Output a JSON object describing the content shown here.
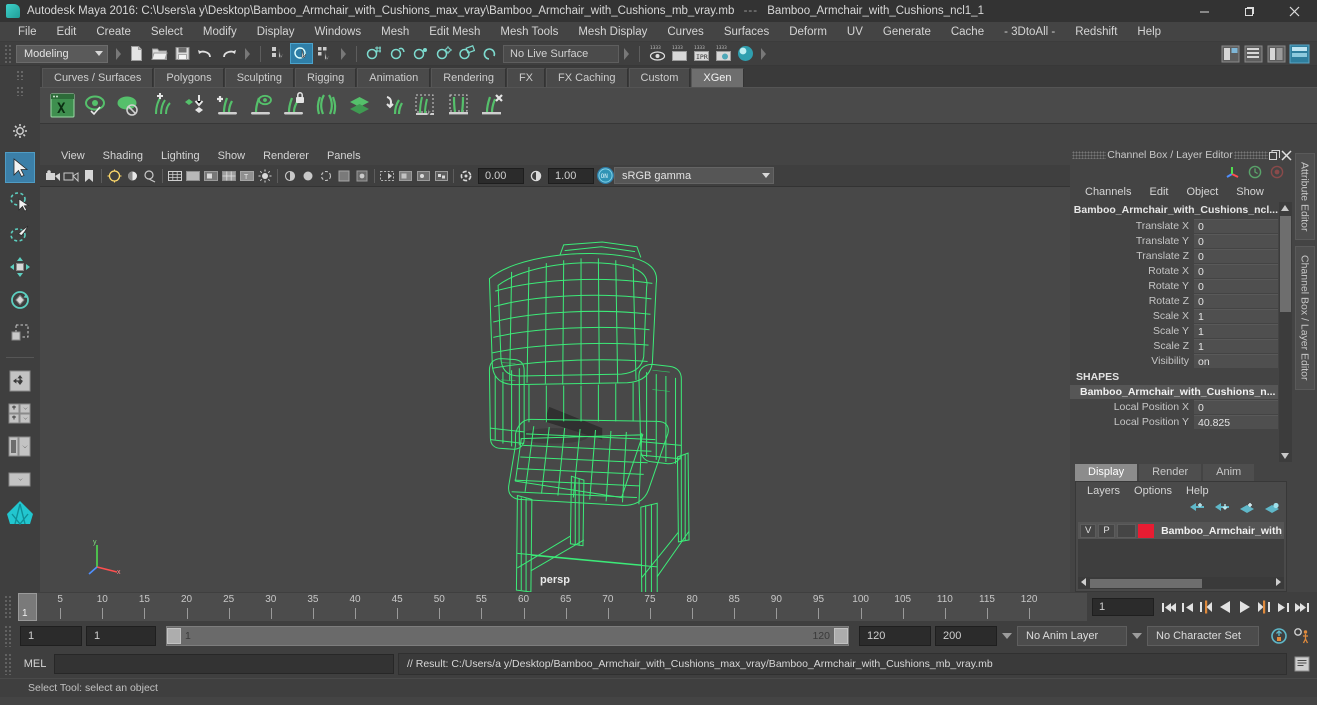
{
  "titlebar": {
    "app_title": "Autodesk Maya 2016: C:\\Users\\a y\\Desktop\\Bamboo_Armchair_with_Cushions_max_vray\\Bamboo_Armchair_with_Cushions_mb_vray.mb",
    "separator": "---",
    "selection_title": "Bamboo_Armchair_with_Cushions_ncl1_1",
    "minimize": "–",
    "maximize": "❐",
    "close": "✕"
  },
  "menubar": {
    "items": [
      "File",
      "Edit",
      "Create",
      "Select",
      "Modify",
      "Display",
      "Windows",
      "Mesh",
      "Edit Mesh",
      "Mesh Tools",
      "Mesh Display",
      "Curves",
      "Surfaces",
      "Deform",
      "UV",
      "Generate",
      "Cache",
      "- 3DtoAll -",
      "Redshift",
      "Help"
    ]
  },
  "statusline": {
    "mode": "Modeling",
    "live_surface": "No Live Surface",
    "icons": [
      "new-scene-icon",
      "open-scene-icon",
      "save-scene-icon",
      "undo-icon",
      "redo-icon",
      "select-hierarchy-icon",
      "select-object-icon",
      "select-component-icon",
      "snap-grid-icon",
      "snap-curve-icon",
      "snap-point-icon",
      "snap-projected-icon",
      "render-view-icon",
      "render-current-frame-icon",
      "ipr-render-icon",
      "render-settings-icon",
      "hypershade-icon"
    ]
  },
  "shelf": {
    "tabs": [
      "Curves / Surfaces",
      "Polygons",
      "Sculpting",
      "Rigging",
      "Animation",
      "Rendering",
      "FX",
      "FX Caching",
      "Custom",
      "XGen"
    ],
    "active_tab": "XGen",
    "icons": [
      "xgen-editor-icon",
      "xgen-preview-icon",
      "xgen-disable-preview-icon",
      "xgen-add-description-icon",
      "xgen-import-icon",
      "xgen-add-guide-icon",
      "xgen-guide-preview-icon",
      "xgen-lock-guide-icon",
      "xgen-part-guides-icon",
      "xgen-layers-icon",
      "xgen-clump-icon",
      "xgen-select-guides-icon",
      "xgen-region-icon",
      "xgen-delete-guides-icon"
    ]
  },
  "toolbox": {
    "tools": [
      "select-tool",
      "lasso-select-tool",
      "paint-select-tool",
      "move-tool",
      "rotate-tool",
      "scale-tool",
      "last-tool-used",
      "four-view-layout",
      "two-pane-layout",
      "outliner-persp-layout",
      "hypershade-persp-layout",
      "persp-layout"
    ],
    "active_tool": "select-tool"
  },
  "viewport": {
    "menus": [
      "View",
      "Shading",
      "Lighting",
      "Show",
      "Renderer",
      "Panels"
    ],
    "exposure_value": "0.00",
    "gamma_value": "1.00",
    "color_management": "sRGB gamma",
    "camera_label": "persp",
    "toolbar_icons": [
      "camera-attributes-icon",
      "bookmark-icon",
      "image-plane-icon",
      "grid-icon",
      "film-gate-icon",
      "resolution-gate-icon",
      "gate-mask-icon",
      "field-chart-icon",
      "safe-action-icon",
      "safe-title-icon",
      "xray-icon",
      "xray-joints-icon",
      "shadows-icon",
      "occlusion-icon",
      "aa-icon",
      "mblur-icon",
      "dof-icon",
      "wireframe-icon",
      "smooth-shade-icon",
      "flat-shade-icon",
      "wireframe-on-shaded-icon",
      "texture-icon",
      "lighting-icon",
      "shadow-icon",
      "two-sided-lighting-icon",
      "isolate-select-icon",
      "panel-zoom-icon",
      "exposure-icon",
      "gamma-icon",
      "color-management-toggle-icon"
    ]
  },
  "channelbox": {
    "panel_title": "Channel Box / Layer Editor",
    "menus": [
      "Channels",
      "Edit",
      "Object",
      "Show"
    ],
    "object_name": "Bamboo_Armchair_with_Cushions_ncl...",
    "attributes": [
      {
        "label": "Translate X",
        "value": "0"
      },
      {
        "label": "Translate Y",
        "value": "0"
      },
      {
        "label": "Translate Z",
        "value": "0"
      },
      {
        "label": "Rotate X",
        "value": "0"
      },
      {
        "label": "Rotate Y",
        "value": "0"
      },
      {
        "label": "Rotate Z",
        "value": "0"
      },
      {
        "label": "Scale X",
        "value": "1"
      },
      {
        "label": "Scale Y",
        "value": "1"
      },
      {
        "label": "Scale Z",
        "value": "1"
      },
      {
        "label": "Visibility",
        "value": "on"
      }
    ],
    "shapes_header": "SHAPES",
    "shape_name": "Bamboo_Armchair_with_Cushions_n...",
    "shape_attributes": [
      {
        "label": "Local Position X",
        "value": "0"
      },
      {
        "label": "Local Position Y",
        "value": "40.825"
      }
    ]
  },
  "layereditor": {
    "tabs": [
      "Display",
      "Render",
      "Anim"
    ],
    "active_tab": "Display",
    "menus": [
      "Layers",
      "Options",
      "Help"
    ],
    "icon_names": [
      "move-layer-up-icon",
      "move-layer-down-icon",
      "new-layer-icon",
      "new-layer-from-selected-icon"
    ],
    "layers": [
      {
        "visibility": "V",
        "playback": "P",
        "color": "#e81c32",
        "name": "Bamboo_Armchair_with_"
      }
    ]
  },
  "side_tabs": [
    "Attribute Editor",
    "Channel Box / Layer Editor"
  ],
  "timeline": {
    "start_label": "1",
    "ticks": [
      5,
      10,
      15,
      20,
      25,
      30,
      35,
      40,
      45,
      50,
      55,
      60,
      65,
      70,
      75,
      80,
      85,
      90,
      95,
      100,
      105,
      110,
      115,
      120
    ],
    "current_frame": "1",
    "playback_buttons": [
      "go-to-start-icon",
      "step-back-keyframe-icon",
      "step-back-frame-icon",
      "play-backwards-icon",
      "play-forwards-icon",
      "step-forward-frame-icon",
      "step-forward-keyframe-icon",
      "go-to-end-icon"
    ]
  },
  "rangeslider": {
    "anim_start": "1",
    "range_start": "1",
    "bar_start_label": "1",
    "bar_end_label": "120",
    "range_end": "120",
    "anim_end": "200",
    "anim_layer": "No Anim Layer",
    "character_set": "No Character Set",
    "auto_key_icon": "auto-keyframe-icon",
    "anim_prefs_icon": "animation-preferences-icon"
  },
  "commandline": {
    "language": "MEL",
    "input_value": "",
    "result_text": "// Result: C:/Users/a y/Desktop/Bamboo_Armchair_with_Cushions_max_vray/Bamboo_Armchair_with_Cushions_mb_vray.mb",
    "script_editor_icon": "script-editor-icon"
  },
  "statusbar": {
    "help_text": "Select Tool: select an object"
  },
  "colors": {
    "accent_blue": "#3b7fa8",
    "wireframe_green": "#3cf07a",
    "layer_red": "#e81c32",
    "panel_bg": "#444444"
  }
}
